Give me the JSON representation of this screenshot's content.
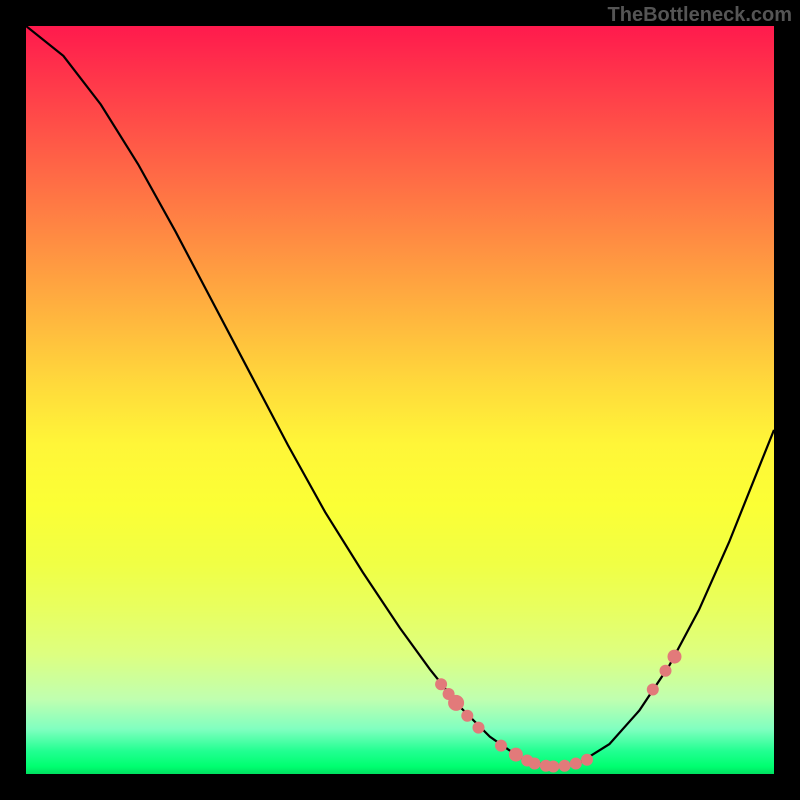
{
  "attribution": "TheBottleneck.com",
  "chart_data": {
    "type": "line",
    "title": "",
    "xlabel": "",
    "ylabel": "",
    "xlim": [
      0,
      1
    ],
    "ylim": [
      0,
      1
    ],
    "curve": [
      {
        "x": 0.0,
        "y": 1.0
      },
      {
        "x": 0.05,
        "y": 0.96
      },
      {
        "x": 0.1,
        "y": 0.895
      },
      {
        "x": 0.15,
        "y": 0.815
      },
      {
        "x": 0.2,
        "y": 0.725
      },
      {
        "x": 0.25,
        "y": 0.63
      },
      {
        "x": 0.3,
        "y": 0.535
      },
      {
        "x": 0.35,
        "y": 0.44
      },
      {
        "x": 0.4,
        "y": 0.35
      },
      {
        "x": 0.45,
        "y": 0.27
      },
      {
        "x": 0.5,
        "y": 0.195
      },
      {
        "x": 0.54,
        "y": 0.14
      },
      {
        "x": 0.58,
        "y": 0.09
      },
      {
        "x": 0.62,
        "y": 0.05
      },
      {
        "x": 0.66,
        "y": 0.022
      },
      {
        "x": 0.7,
        "y": 0.01
      },
      {
        "x": 0.74,
        "y": 0.015
      },
      {
        "x": 0.78,
        "y": 0.04
      },
      {
        "x": 0.82,
        "y": 0.085
      },
      {
        "x": 0.86,
        "y": 0.145
      },
      {
        "x": 0.9,
        "y": 0.22
      },
      {
        "x": 0.94,
        "y": 0.31
      },
      {
        "x": 0.98,
        "y": 0.41
      },
      {
        "x": 1.0,
        "y": 0.46
      }
    ],
    "dots": [
      {
        "x": 0.555,
        "y": 0.12,
        "r": 6
      },
      {
        "x": 0.565,
        "y": 0.107,
        "r": 6
      },
      {
        "x": 0.575,
        "y": 0.095,
        "r": 8
      },
      {
        "x": 0.59,
        "y": 0.078,
        "r": 6
      },
      {
        "x": 0.605,
        "y": 0.062,
        "r": 6
      },
      {
        "x": 0.635,
        "y": 0.038,
        "r": 6
      },
      {
        "x": 0.655,
        "y": 0.026,
        "r": 7
      },
      {
        "x": 0.67,
        "y": 0.018,
        "r": 6
      },
      {
        "x": 0.68,
        "y": 0.014,
        "r": 6
      },
      {
        "x": 0.695,
        "y": 0.011,
        "r": 6
      },
      {
        "x": 0.705,
        "y": 0.01,
        "r": 6
      },
      {
        "x": 0.72,
        "y": 0.011,
        "r": 6
      },
      {
        "x": 0.735,
        "y": 0.014,
        "r": 6
      },
      {
        "x": 0.75,
        "y": 0.019,
        "r": 6
      },
      {
        "x": 0.838,
        "y": 0.113,
        "r": 6
      },
      {
        "x": 0.855,
        "y": 0.138,
        "r": 6
      },
      {
        "x": 0.867,
        "y": 0.157,
        "r": 7
      }
    ]
  }
}
